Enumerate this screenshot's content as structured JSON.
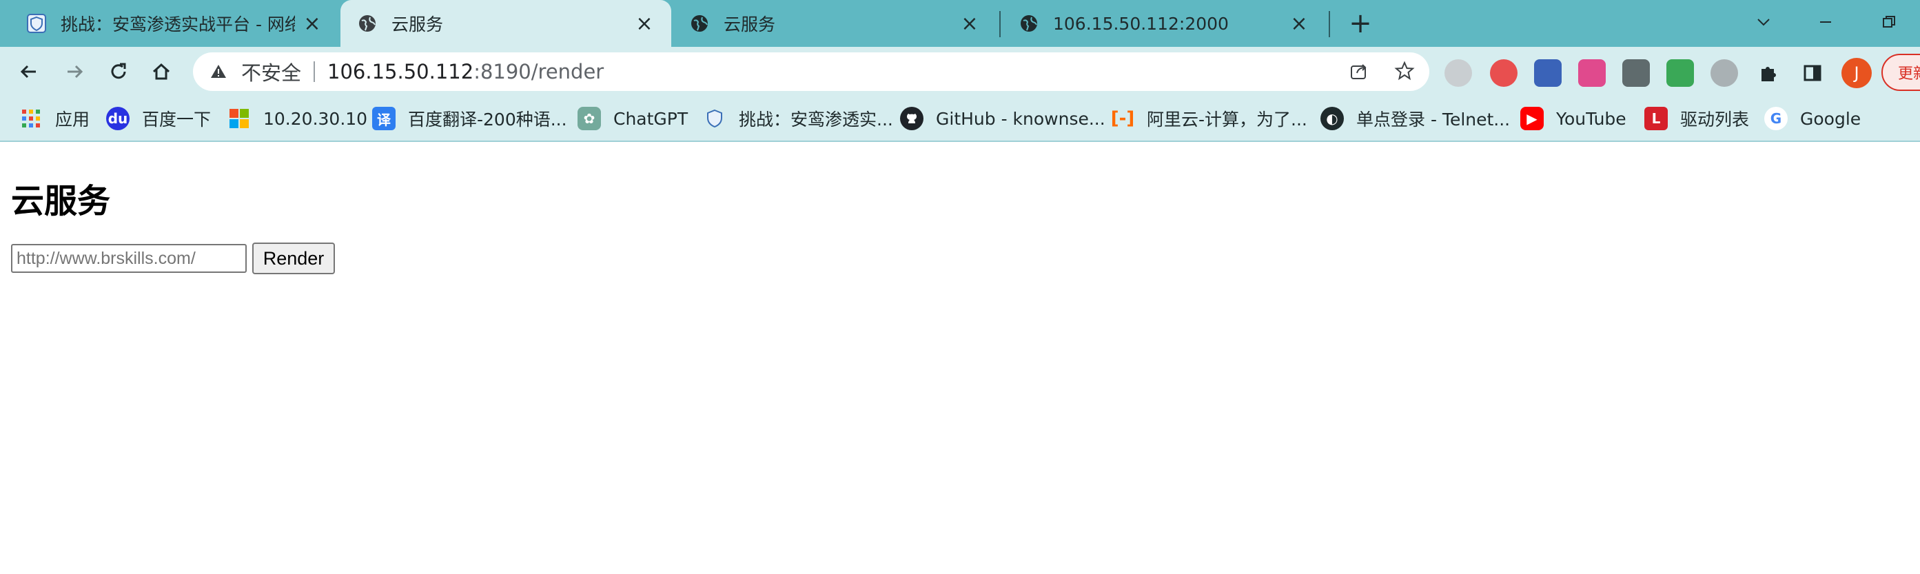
{
  "tabs": [
    {
      "title": "挑战：安鸾渗透实战平台 - 网络安",
      "icon": "shield-icon",
      "active": false
    },
    {
      "title": "云服务",
      "icon": "globe-icon",
      "active": true
    },
    {
      "title": "云服务",
      "icon": "globe-icon",
      "active": false
    },
    {
      "title": "106.15.50.112:2000",
      "icon": "globe-icon",
      "active": false
    }
  ],
  "address_bar": {
    "security_label": "不安全",
    "host": "106.15.50.112",
    "path": ":8190/render"
  },
  "profile": {
    "initial": "J"
  },
  "update_button": {
    "label": "更新"
  },
  "bookmarks": [
    {
      "label": "应用",
      "icon": "apps-grid-icon"
    },
    {
      "label": "百度一下",
      "icon": "baidu-icon"
    },
    {
      "label": "10.20.30.10",
      "icon": "windows-icon"
    },
    {
      "label": "百度翻译-200种语...",
      "icon": "translate-icon"
    },
    {
      "label": "ChatGPT",
      "icon": "chatgpt-icon"
    },
    {
      "label": "挑战：安鸾渗透实...",
      "icon": "shield-icon"
    },
    {
      "label": "GitHub - knownse...",
      "icon": "github-icon"
    },
    {
      "label": "阿里云-计算，为了...",
      "icon": "aliyun-icon"
    },
    {
      "label": "单点登录 - Telnet...",
      "icon": "telnet-icon"
    },
    {
      "label": "YouTube",
      "icon": "youtube-icon"
    },
    {
      "label": "驱动列表",
      "icon": "driver-icon"
    },
    {
      "label": "Google",
      "icon": "google-icon"
    }
  ],
  "page": {
    "heading": "云服务",
    "url_input_placeholder": "http://www.brskills.com/",
    "render_button": "Render"
  },
  "colors": {
    "tabstrip": "#5fb8c2",
    "toolbar": "#d6edef",
    "avatar": "#e8531f"
  }
}
